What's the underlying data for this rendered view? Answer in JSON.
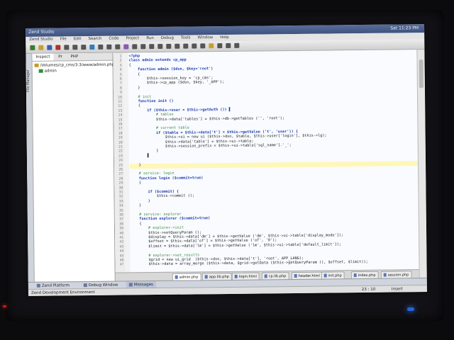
{
  "window": {
    "title": "Zend Studio",
    "clock": "Sat 11:23 PM"
  },
  "menu": [
    "Zend Studio",
    "File",
    "Edit",
    "Search",
    "Code",
    "Project",
    "Run",
    "Debug",
    "Tools",
    "Window",
    "Help"
  ],
  "left_panel": {
    "vertical_label": "File Manager",
    "tabs": [
      "Inspect",
      "Pr",
      "PHP"
    ],
    "tree_path": "/Volumes/cp_cms/3.3/www/admin.php",
    "tree_child": "admin"
  },
  "code_lines": [
    {
      "n": "1",
      "text": "<?php"
    },
    {
      "n": "2",
      "text": "class admin extends cp_app"
    },
    {
      "n": "3",
      "text": "{"
    },
    {
      "n": "4",
      "text": "    function admin ($dsn, $key='root')"
    },
    {
      "n": "5",
      "text": "    {"
    },
    {
      "n": "6",
      "text": "        $this->session_key = 'cp_cms';"
    },
    {
      "n": "7",
      "text": "        $this->cp_app ($dsn, $key, '_APP');"
    },
    {
      "n": "8",
      "text": "    }"
    },
    {
      "n": "9",
      "text": ""
    },
    {
      "n": "10",
      "text": "    # init"
    },
    {
      "n": "11",
      "text": "    function init ()"
    },
    {
      "n": "12",
      "text": "    {"
    },
    {
      "n": "13",
      "text": "        if ($this->user = $this->getAuth ()) ▌"
    },
    {
      "n": "14",
      "text": "            # tables"
    },
    {
      "n": "15",
      "text": "            $this->data['tables'] = $this->db->getTables ('', 'root');"
    },
    {
      "n": "16",
      "text": ""
    },
    {
      "n": "17",
      "text": "            # current table"
    },
    {
      "n": "18",
      "text": "            if ($table = $this->data['t'] = $this->getValue ('t', 'user')) {"
    },
    {
      "n": "19",
      "text": "                $this->ui = new ui ($this->dsn, $table, $this->user['login'], $this->lg);"
    },
    {
      "n": "20",
      "text": "                $this->data['table'] = $this->ui->table;"
    },
    {
      "n": "21",
      "text": "                $this->session_prefix = $this->ui->table['sql_name'].'_';"
    },
    {
      "n": "22",
      "text": "            }"
    },
    {
      "n": "23",
      "text": "        ▌"
    },
    {
      "n": "24",
      "text": ""
    },
    {
      "n": "25",
      "text": "    }"
    },
    {
      "n": "26",
      "text": ""
    },
    {
      "n": "27",
      "text": "    # service: login"
    },
    {
      "n": "28",
      "text": "    function login ($commit=true)"
    },
    {
      "n": "29",
      "text": "    {"
    },
    {
      "n": "30",
      "text": ""
    },
    {
      "n": "31",
      "text": "        if ($commit) {"
    },
    {
      "n": "32",
      "text": "            $this->commit ();"
    },
    {
      "n": "33",
      "text": "        }"
    },
    {
      "n": "34",
      "text": "    }"
    },
    {
      "n": "35",
      "text": ""
    },
    {
      "n": "36",
      "text": "    # service: explorer"
    },
    {
      "n": "37",
      "text": "    function explorer ($commit=true)"
    },
    {
      "n": "38",
      "text": "    {"
    },
    {
      "n": "39",
      "text": "        # explorer->init"
    },
    {
      "n": "40",
      "text": "        $this->setQueryParam ();"
    },
    {
      "n": "41",
      "text": "        $display = $this->data['dm'] = $this->getValue ('dm', $this->ui->table['display_mode']);"
    },
    {
      "n": "42",
      "text": "        $offset = $this->data['of'] = $this->getValue ('of', '0');"
    },
    {
      "n": "43",
      "text": "        $limit = $this->data['lm'] = $this->getValue ('lm', $this->ui->table['default_limit']);"
    },
    {
      "n": "44",
      "text": ""
    },
    {
      "n": "45",
      "text": "        # explorer->set_results"
    },
    {
      "n": "46",
      "text": "        $grid = new ui_grid  ($this->dsn, $this->data['t'], 'root', APP_LANG);"
    },
    {
      "n": "47",
      "text": "        $this->data = array_merge ($this->data, $grid->getData ($this->getQueryParam (), $offset, $limit));"
    }
  ],
  "file_tabs": [
    "admin.php",
    "app.lib.php",
    "login.html",
    "cp.lib.php",
    "header.html",
    "init.php",
    "index.php",
    "session.php"
  ],
  "bottom_tabs": [
    "Zend Platform",
    "Debug Window",
    "Messages"
  ],
  "status": {
    "environment": "Zend Development Environment",
    "position": "23 : 10",
    "mode": "Insert"
  }
}
